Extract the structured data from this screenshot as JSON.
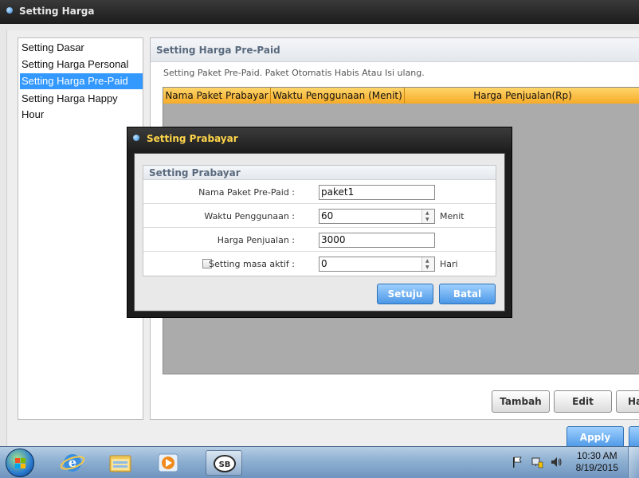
{
  "window": {
    "title": "Setting Harga"
  },
  "sidebar": {
    "items": [
      {
        "label": "Setting Dasar",
        "selected": false
      },
      {
        "label": "Setting Harga Personal",
        "selected": false
      },
      {
        "label": "Setting Harga Pre-Paid",
        "selected": true
      },
      {
        "label": "Setting Harga Happy Hour",
        "selected": false
      }
    ]
  },
  "panel": {
    "title": "Setting Harga Pre-Paid",
    "description": "Setting Paket Pre-Paid. Paket Otomatis Habis Atau Isi ulang.",
    "columns": [
      "Nama Paket Prabayar",
      "Waktu Penggunaan (Menit)",
      "Harga Penjualan(Rp)"
    ],
    "buttons": {
      "add": "Tambah",
      "edit": "Edit",
      "delete_partial": "Ha"
    },
    "apply": "Apply"
  },
  "dialog": {
    "title": "Setting Prabayar",
    "group_title": "Setting Prabayar",
    "fields": {
      "package_name": {
        "label": "Nama Paket Pre-Paid :",
        "value": "paket1"
      },
      "usage_time": {
        "label": "Waktu Penggunaan :",
        "value": "60",
        "unit": "Menit"
      },
      "price": {
        "label": "Harga Penjualan :",
        "value": "3000"
      },
      "active_period": {
        "label": "Setting masa aktif :",
        "value": "0",
        "unit": "Hari",
        "checked": false
      }
    },
    "ok": "Setuju",
    "cancel": "Batal"
  },
  "taskbar": {
    "apps": [
      "start-orb",
      "internet-explorer-icon",
      "windows-explorer-icon",
      "media-player-icon",
      "sb-app-icon"
    ],
    "clock": {
      "time": "10:30 AM",
      "date": "8/19/2015"
    }
  },
  "colors": {
    "selection": "#3399ff",
    "grid_header": "#f6ab27",
    "dialog_title": "#ffd54a",
    "primary_button": "#4b97e6"
  }
}
